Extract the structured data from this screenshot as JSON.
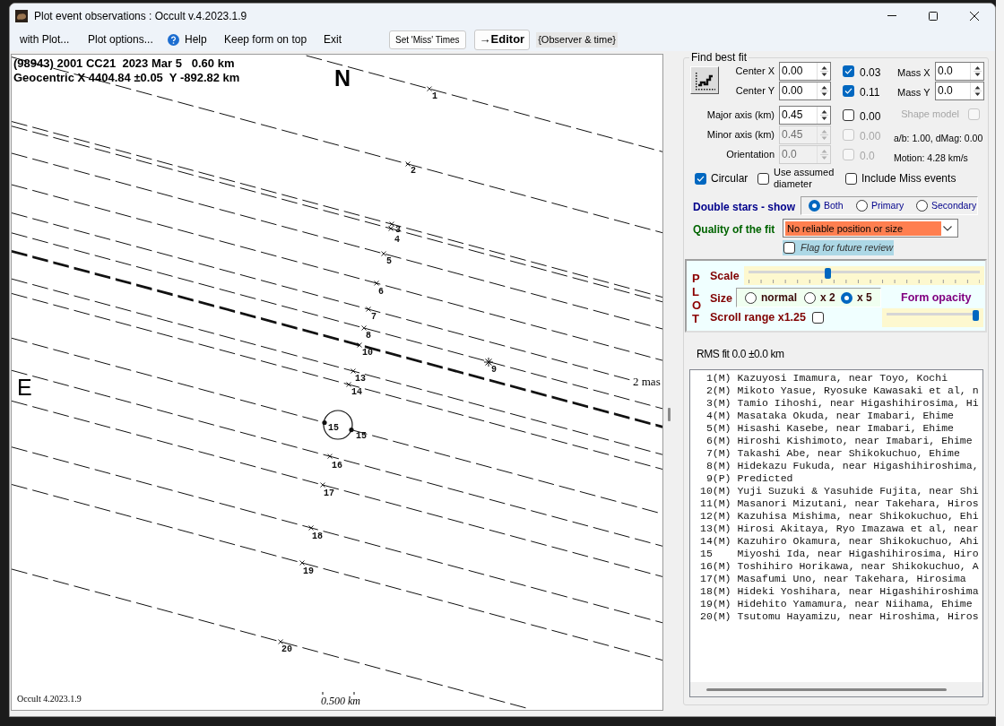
{
  "window": {
    "title": "Plot event observations : Occult v.4.2023.1.9"
  },
  "menu": [
    {
      "kind": "item",
      "label": "with Plot..."
    },
    {
      "kind": "item",
      "label": "Plot options..."
    },
    {
      "kind": "help",
      "label": "Help"
    },
    {
      "kind": "item",
      "label": "Keep form on top"
    },
    {
      "kind": "item",
      "label": "Exit"
    }
  ],
  "toolbar": [
    {
      "kind": "button",
      "label": "Set 'Miss' Times"
    },
    {
      "kind": "bold_button",
      "label": "→Editor"
    },
    {
      "kind": "label",
      "label": "{Observer & time}"
    }
  ],
  "plot": {
    "title": "(98943) 2001 CC21  2023 Mar 5   0.60 km",
    "subtitle": "Geocentric X 4404.84 ±0.05  Y -892.82 km",
    "north": "N",
    "east": "E",
    "limit_label": "2 mas",
    "version": "Occult 4.2023.1.9",
    "scale_bar": "0.500 km",
    "chord_labels": [
      "1",
      "2",
      "3",
      "4",
      "5",
      "6",
      "7",
      "8",
      "9",
      "10",
      "13",
      "14",
      "15",
      "15",
      "16",
      "17",
      "18",
      "19",
      "20"
    ]
  },
  "fit": {
    "title": "Find best fit",
    "rows": [
      {
        "label": "Center X",
        "value": "0.00",
        "disabled": false,
        "fit": {
          "value": "0.03",
          "checked": true,
          "disabled": false
        },
        "side": {
          "kind": "field",
          "label": "Mass X",
          "value": "0.0"
        }
      },
      {
        "label": "Center Y",
        "value": "0.00",
        "disabled": false,
        "fit": {
          "value": "0.11",
          "checked": true,
          "disabled": false
        },
        "side": {
          "kind": "field",
          "label": "Mass Y",
          "value": "0.0"
        }
      },
      {
        "label": "Major axis (km)",
        "value": "0.45",
        "disabled": false,
        "fit": {
          "value": "0.00",
          "checked": false,
          "disabled": false
        },
        "side": {
          "kind": "checkbox",
          "label": "Shape model",
          "checked": false,
          "disabled": true
        }
      },
      {
        "label": "Minor axis (km)",
        "value": "0.45",
        "disabled": true,
        "fit": {
          "value": "0.00",
          "checked": false,
          "disabled": true
        },
        "side": {
          "kind": "text",
          "text": "a/b: 1.00, dMag: 0.00"
        }
      },
      {
        "label": "Orientation",
        "value": "0.0",
        "disabled": true,
        "fit": {
          "value": "0.0",
          "checked": false,
          "disabled": true
        },
        "side": {
          "kind": "text",
          "text": "Motion: 4.28 km/s"
        }
      }
    ],
    "options": [
      {
        "label": "Circular",
        "checked": true
      },
      {
        "label": "Use assumed diameter",
        "checked": false
      },
      {
        "label": "Include Miss events",
        "checked": false
      }
    ],
    "double_stars": {
      "label": "Double stars - show",
      "options": [
        {
          "label": "Both",
          "selected": true
        },
        {
          "label": "Primary",
          "selected": false
        },
        {
          "label": "Secondary",
          "selected": false
        }
      ]
    },
    "quality": {
      "label": "Quality of the fit",
      "value": "No reliable position or size"
    },
    "flag": {
      "label": "Flag for future review",
      "checked": false
    }
  },
  "plot_panel": {
    "title": "PLOT",
    "scale": {
      "label": "Scale",
      "level": 0.34
    },
    "size": {
      "label": "Size",
      "options": [
        {
          "label": "normal",
          "selected": false
        },
        {
          "label": "x 2",
          "selected": false
        },
        {
          "label": "x 5",
          "selected": true
        }
      ]
    },
    "opacity": {
      "label": "Form opacity",
      "level": 1
    },
    "scroll_range": {
      "label": "Scroll range x1.25",
      "checked": false
    }
  },
  "rms_text": "RMS fit 0.0 ±0.0 km",
  "observers": [
    " 1(M) Kazuyosi Imamura, near Toyo, Kochi",
    " 2(M) Mikoto Yasue, Ryosuke Kawasaki et al, n",
    " 3(M) Tamio Iihoshi, near Higashihirosima, Hi",
    " 4(M) Masataka Okuda, near Imabari, Ehime",
    " 5(M) Hisashi Kasebe, near Imabari, Ehime",
    " 6(M) Hiroshi Kishimoto, near Imabari, Ehime",
    " 7(M) Takashi Abe, near Shikokuchuo, Ehime",
    " 8(M) Hidekazu Fukuda, near Higashihiroshima,",
    " 9(P) Predicted",
    "10(M) Yuji Suzuki & Yasuhide Fujita, near Shi",
    "11(M) Masanori Mizutani, near Takehara, Hiros",
    "12(M) Kazuhisa Mishima, near Shikokuchuo, Ehi",
    "13(M) Hirosi Akitaya, Ryo Imazawa et al, near",
    "14(M) Kazuhiro Okamura, near Shikokuchuo, Ahi",
    "15    Miyoshi Ida, near Higashihirosima, Hiro",
    "16(M) Toshihiro Horikawa, near Shikokuchuo, A",
    "17(M) Masafumi Uno, near Takehara, Hirosima",
    "18(M) Hideki Yoshihara, near Higashihiroshima",
    "19(M) Hidehito Yamamura, near Niihama, Ehime",
    "20(M) Tsutomu Hayamizu, near Hiroshima, Hiros"
  ]
}
